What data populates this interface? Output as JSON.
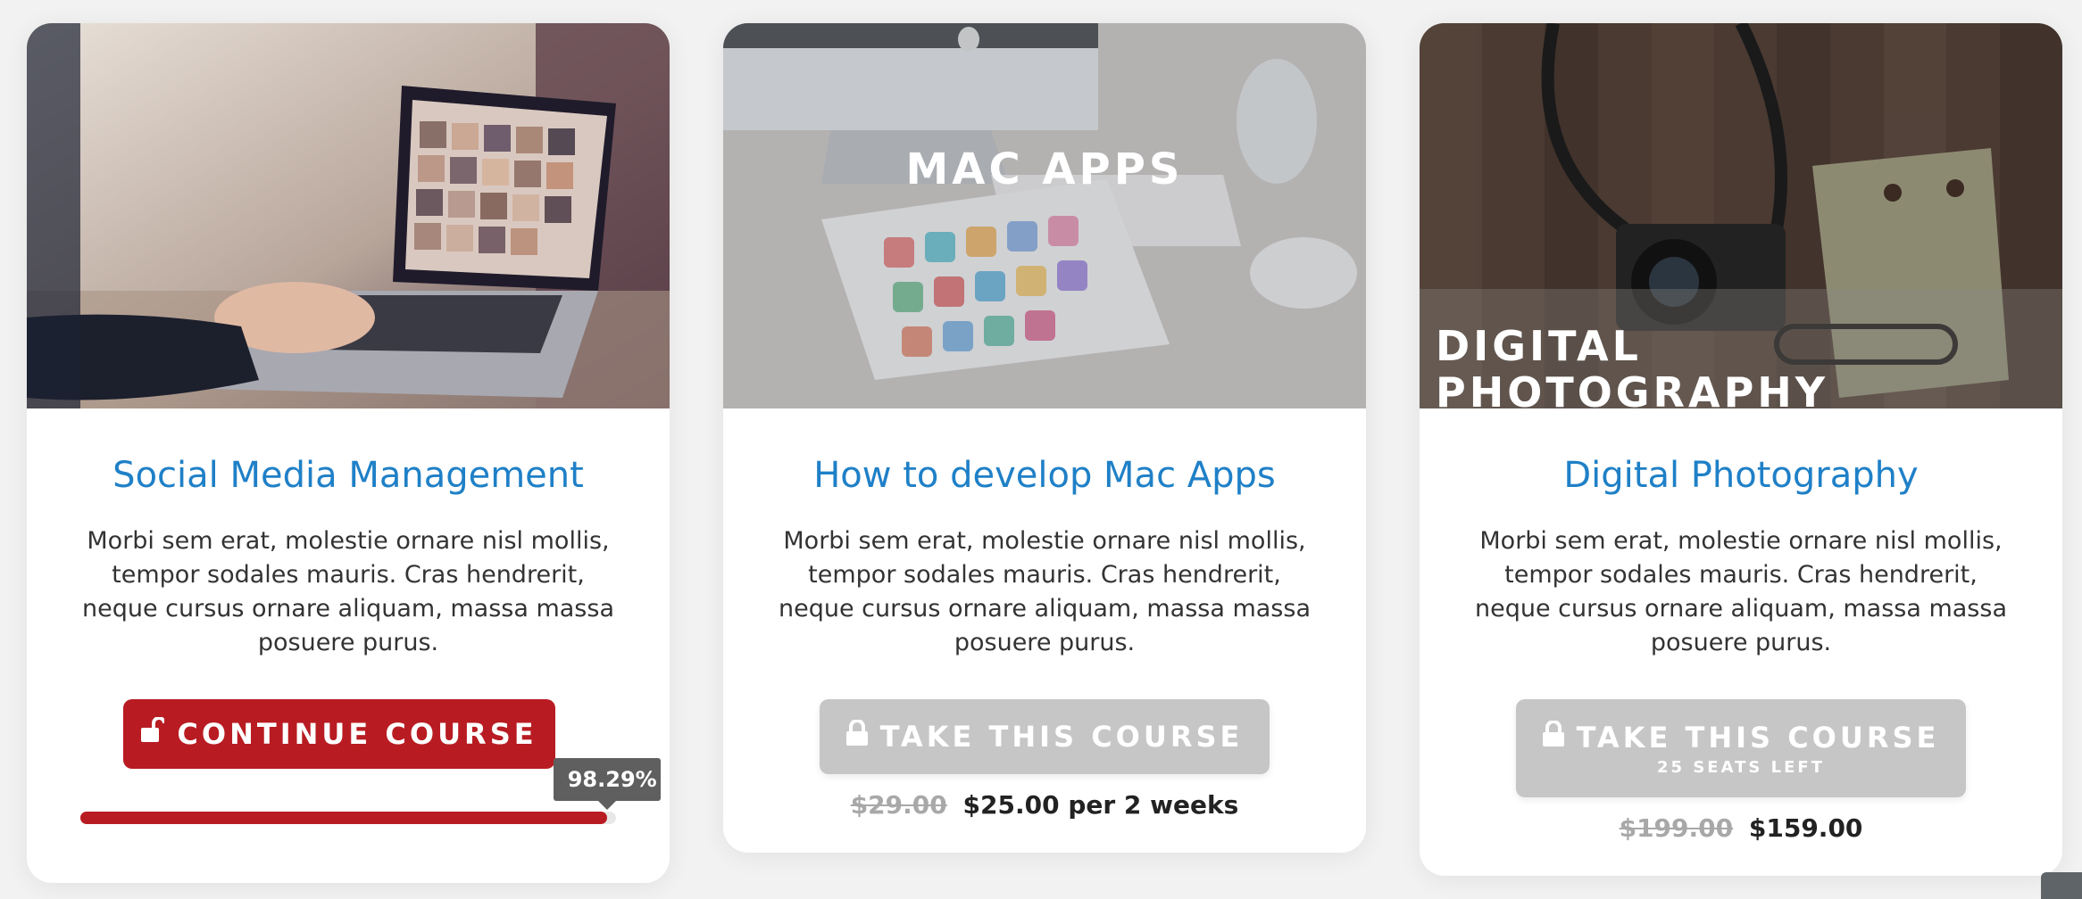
{
  "courses": [
    {
      "title": "Social Media Management",
      "description": "Morbi sem erat, molestie ornare nisl mollis, tempor sodales mauris. Cras hendrerit, neque cursus ornare aliquam, massa massa posuere purus.",
      "button_label": "CONTINUE COURSE",
      "button_icon": "unlock-icon",
      "button_color": "#b81c22",
      "progress": 98.29,
      "progress_label": "98.29%"
    },
    {
      "title": "How to develop Mac Apps",
      "image_text": "MAC APPS",
      "description": "Morbi sem erat, molestie ornare nisl mollis, tempor sodales mauris. Cras hendrerit, neque cursus ornare aliquam, massa massa posuere purus.",
      "button_label": "TAKE THIS COURSE",
      "button_icon": "lock-icon",
      "button_color": "#c6c6c6",
      "old_price": "$29.00",
      "price": "$25.00 per 2 weeks"
    },
    {
      "title": "Digital Photography",
      "image_text_line1": "DIGITAL",
      "image_text_line2": "PHOTOGRAPHY",
      "description": "Morbi sem erat, molestie ornare nisl mollis, tempor sodales mauris. Cras hendrerit, neque cursus ornare aliquam, massa massa posuere purus.",
      "button_label": "TAKE THIS COURSE",
      "button_sublabel": "25 SEATS LEFT",
      "button_icon": "lock-icon",
      "button_color": "#c6c6c6",
      "old_price": "$199.00",
      "price": "$159.00"
    }
  ],
  "colors": {
    "title": "#1f80c7",
    "accent_red": "#b81c22",
    "disabled_grey": "#c6c6c6"
  }
}
